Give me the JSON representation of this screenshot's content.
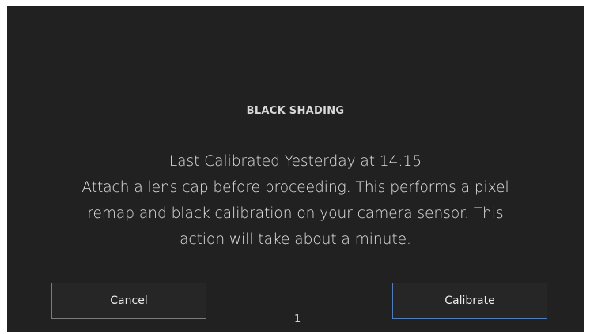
{
  "dialog": {
    "title": "BLACK SHADING",
    "last_calibrated": "Last Calibrated Yesterday at 14:15",
    "message_lines": [
      "Attach a lens cap before proceeding. This performs a pixel",
      "remap and black calibration on your camera sensor. This",
      "action will take about a minute."
    ]
  },
  "buttons": {
    "cancel_label": "Cancel",
    "calibrate_label": "Calibrate"
  },
  "footer": {
    "page_number": "1"
  },
  "colors": {
    "background": "#212121",
    "text": "#e6e6e6",
    "button_border": "#7c7c7c",
    "accent_border": "#4f7dbe"
  }
}
